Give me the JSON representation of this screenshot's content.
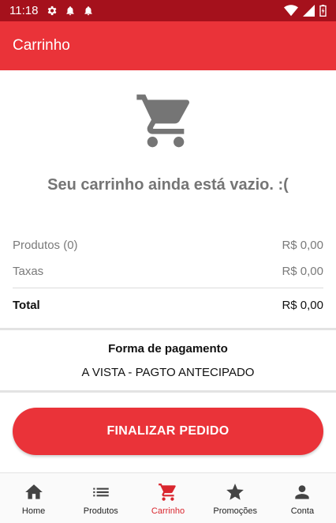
{
  "status_bar": {
    "time": "11:18"
  },
  "app_bar": {
    "title": "Carrinho"
  },
  "empty_cart": {
    "message": "Seu carrinho ainda está vazio. :("
  },
  "summary": {
    "products_label": "Produtos (0)",
    "products_value": "R$ 0,00",
    "taxes_label": "Taxas",
    "taxes_value": "R$ 0,00",
    "total_label": "Total",
    "total_value": "R$ 0,00"
  },
  "payment": {
    "title": "Forma de pagamento",
    "value": "A VISTA - PAGTO ANTECIPADO"
  },
  "actions": {
    "finalize_label": "FINALIZAR PEDIDO"
  },
  "bottom_nav": {
    "items": [
      {
        "label": "Home",
        "icon": "home-icon"
      },
      {
        "label": "Produtos",
        "icon": "list-icon"
      },
      {
        "label": "Carrinho",
        "icon": "cart-icon"
      },
      {
        "label": "Promoções",
        "icon": "star-icon"
      },
      {
        "label": "Conta",
        "icon": "person-icon"
      }
    ],
    "active_index": 2
  },
  "colors": {
    "status_bar": "#a5111c",
    "primary": "#ea3339",
    "active_nav": "#d9262e",
    "muted_text": "#757575"
  }
}
